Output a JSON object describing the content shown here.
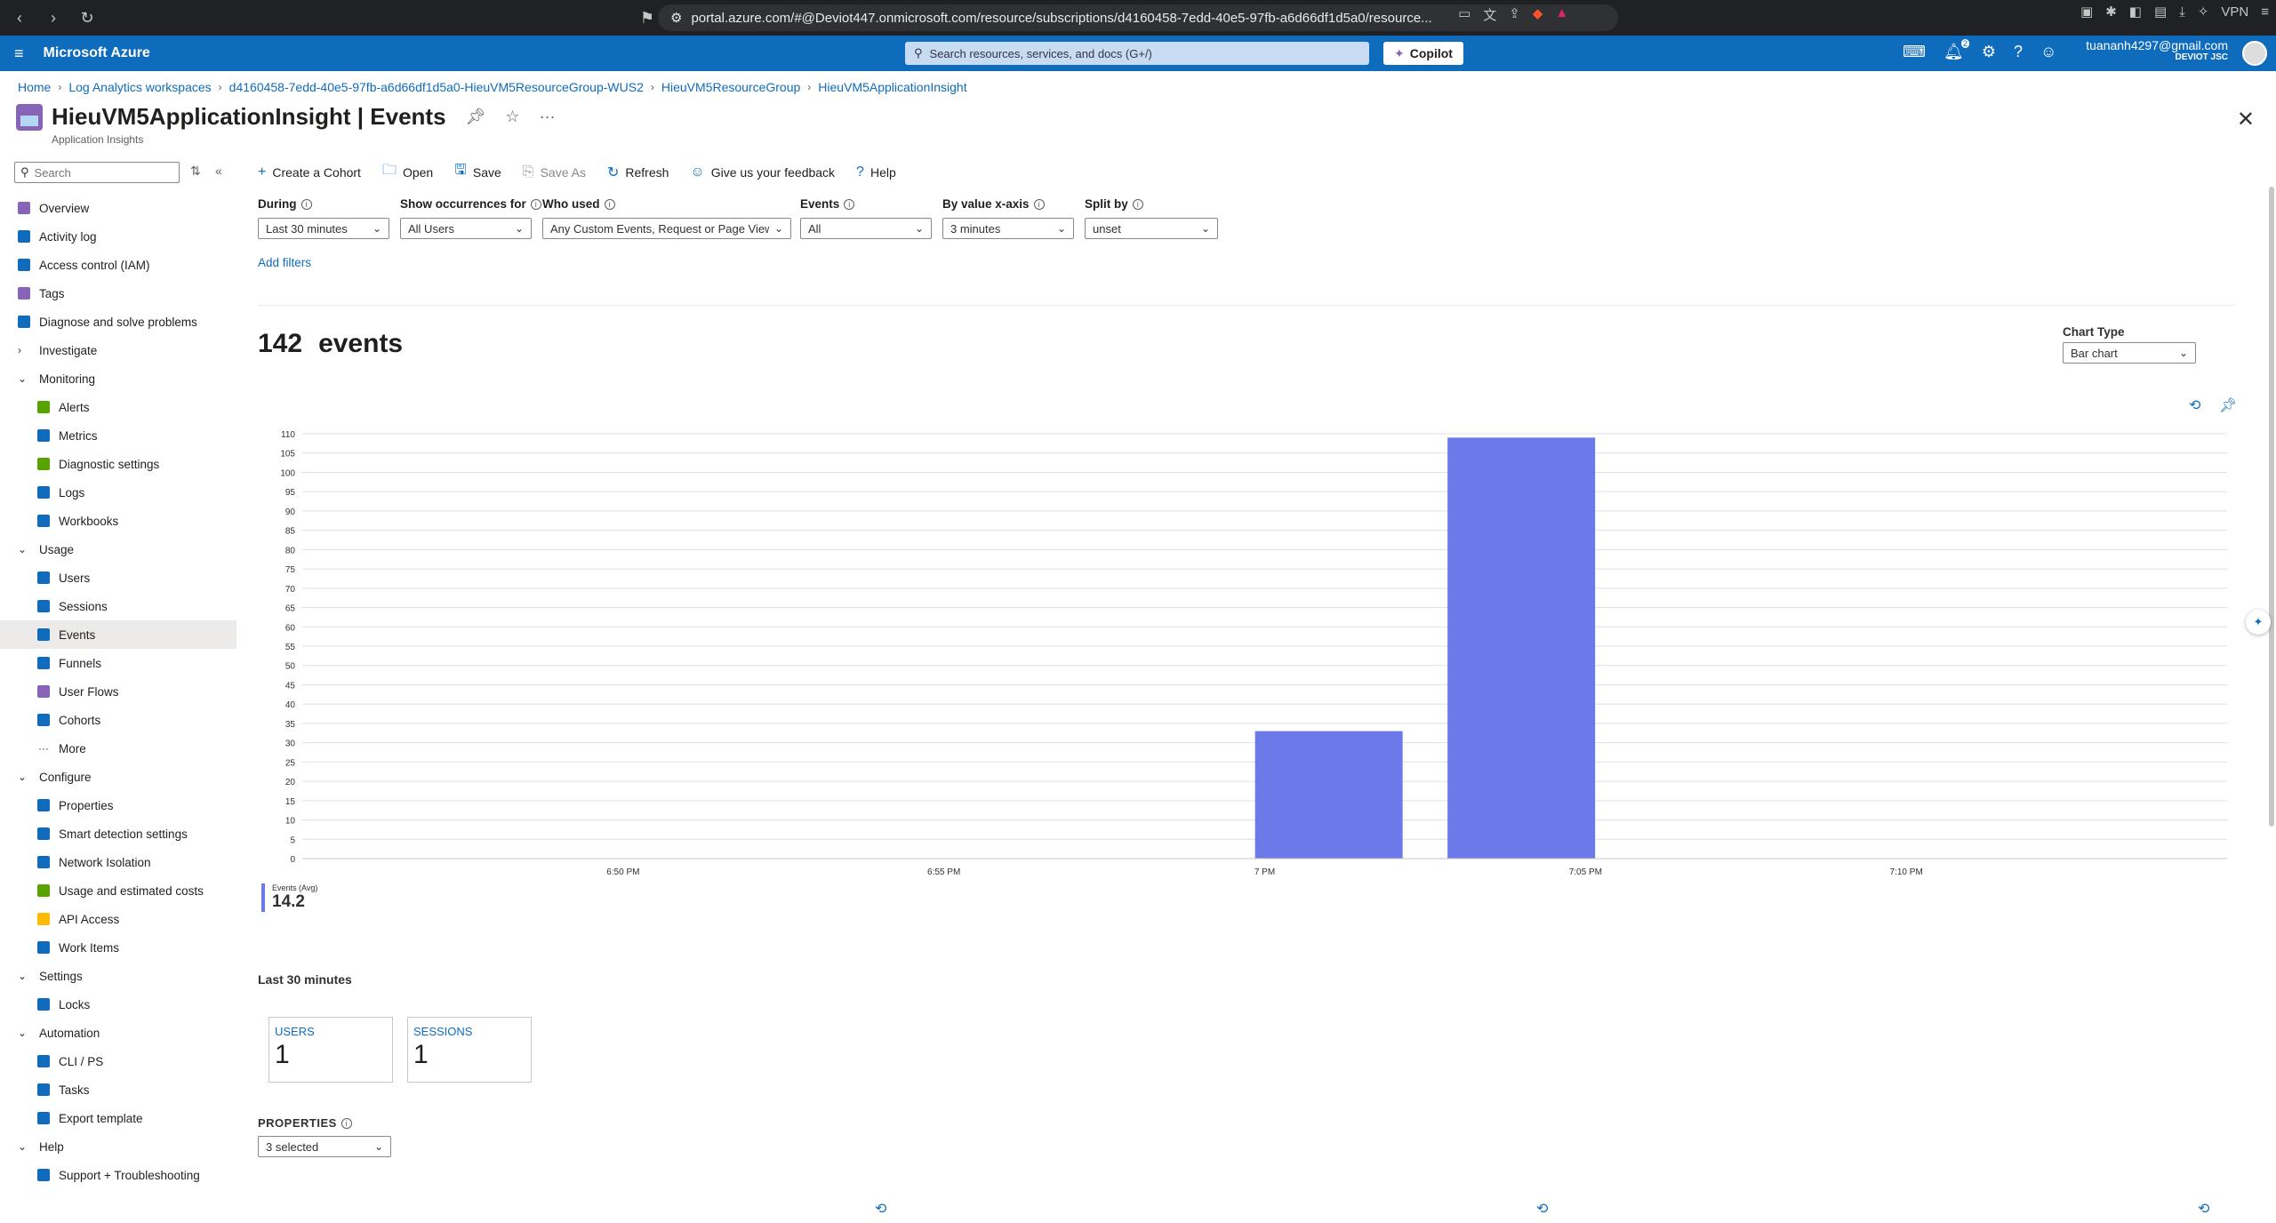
{
  "browser": {
    "url": "portal.azure.com/#@Deviot447.onmicrosoft.com/resource/subscriptions/d4160458-7edd-40e5-97fb-a6d66df1d5a0/resource...",
    "vpn": "VPN"
  },
  "header": {
    "brand": "Microsoft Azure",
    "search_placeholder": "Search resources, services, and docs (G+/)",
    "copilot": "Copilot",
    "notifications_badge": "2",
    "email": "tuananh4297@gmail.com",
    "org": "DEVIOT JSC"
  },
  "breadcrumb": [
    "Home",
    "Log Analytics workspaces",
    "d4160458-7edd-40e5-97fb-a6d66df1d5a0-HieuVM5ResourceGroup-WUS2",
    "HieuVM5ResourceGroup",
    "HieuVM5ApplicationInsight"
  ],
  "page": {
    "title": "HieuVM5ApplicationInsight | Events",
    "subtitle": "Application Insights"
  },
  "sidebar": {
    "search_placeholder": "Search",
    "items": [
      {
        "label": "Overview",
        "level": "top",
        "icon": "overview-icon",
        "color": "#8764b8"
      },
      {
        "label": "Activity log",
        "level": "top",
        "icon": "activity-log-icon",
        "color": "#0f6cbd"
      },
      {
        "label": "Access control (IAM)",
        "level": "top",
        "icon": "iam-icon",
        "color": "#0f6cbd"
      },
      {
        "label": "Tags",
        "level": "top",
        "icon": "tag-icon",
        "color": "#8764b8"
      },
      {
        "label": "Diagnose and solve problems",
        "level": "top",
        "icon": "wrench-icon",
        "color": "#0f6cbd"
      },
      {
        "label": "Investigate",
        "level": "group",
        "expanded": false
      },
      {
        "label": "Monitoring",
        "level": "group",
        "expanded": true
      },
      {
        "label": "Alerts",
        "level": "sub",
        "icon": "alerts-icon",
        "color": "#57a300"
      },
      {
        "label": "Metrics",
        "level": "sub",
        "icon": "metrics-icon",
        "color": "#0f6cbd"
      },
      {
        "label": "Diagnostic settings",
        "level": "sub",
        "icon": "diagnostic-settings-icon",
        "color": "#57a300"
      },
      {
        "label": "Logs",
        "level": "sub",
        "icon": "logs-icon",
        "color": "#0f6cbd"
      },
      {
        "label": "Workbooks",
        "level": "sub",
        "icon": "workbooks-icon",
        "color": "#0f6cbd"
      },
      {
        "label": "Usage",
        "level": "group",
        "expanded": true
      },
      {
        "label": "Users",
        "level": "sub",
        "icon": "users-icon",
        "color": "#0f6cbd"
      },
      {
        "label": "Sessions",
        "level": "sub",
        "icon": "sessions-icon",
        "color": "#0f6cbd"
      },
      {
        "label": "Events",
        "level": "sub",
        "icon": "events-icon",
        "color": "#0f6cbd",
        "active": true
      },
      {
        "label": "Funnels",
        "level": "sub",
        "icon": "funnels-icon",
        "color": "#0f6cbd"
      },
      {
        "label": "User Flows",
        "level": "sub",
        "icon": "user-flows-icon",
        "color": "#8764b8"
      },
      {
        "label": "Cohorts",
        "level": "sub",
        "icon": "cohorts-icon",
        "color": "#0f6cbd"
      },
      {
        "label": "More",
        "level": "sub",
        "icon": "more-icon",
        "color": "#323130"
      },
      {
        "label": "Configure",
        "level": "group",
        "expanded": true
      },
      {
        "label": "Properties",
        "level": "sub",
        "icon": "properties-icon",
        "color": "#0f6cbd"
      },
      {
        "label": "Smart detection settings",
        "level": "sub",
        "icon": "smart-detection-icon",
        "color": "#0f6cbd"
      },
      {
        "label": "Network Isolation",
        "level": "sub",
        "icon": "network-isolation-icon",
        "color": "#0f6cbd"
      },
      {
        "label": "Usage and estimated costs",
        "level": "sub",
        "icon": "costs-icon",
        "color": "#57a300"
      },
      {
        "label": "API Access",
        "level": "sub",
        "icon": "api-key-icon",
        "color": "#ffb900"
      },
      {
        "label": "Work Items",
        "level": "sub",
        "icon": "work-items-icon",
        "color": "#0f6cbd"
      },
      {
        "label": "Settings",
        "level": "group",
        "expanded": true
      },
      {
        "label": "Locks",
        "level": "sub",
        "icon": "lock-icon",
        "color": "#0f6cbd"
      },
      {
        "label": "Automation",
        "level": "group",
        "expanded": true
      },
      {
        "label": "CLI / PS",
        "level": "sub",
        "icon": "cli-icon",
        "color": "#0f6cbd"
      },
      {
        "label": "Tasks",
        "level": "sub",
        "icon": "tasks-icon",
        "color": "#0f6cbd"
      },
      {
        "label": "Export template",
        "level": "sub",
        "icon": "export-template-icon",
        "color": "#0f6cbd"
      },
      {
        "label": "Help",
        "level": "group",
        "expanded": true
      },
      {
        "label": "Support + Troubleshooting",
        "level": "sub",
        "icon": "support-icon",
        "color": "#0f6cbd"
      }
    ]
  },
  "toolbar": {
    "create_cohort": "Create a Cohort",
    "open": "Open",
    "save": "Save",
    "save_as": "Save As",
    "refresh": "Refresh",
    "feedback": "Give us your feedback",
    "help": "Help"
  },
  "filters": {
    "during": {
      "label": "During",
      "value": "Last 30 minutes"
    },
    "occurrences": {
      "label": "Show occurrences for",
      "value": "All Users"
    },
    "who_used": {
      "label": "Who used",
      "value": "Any Custom Events, Request or Page View"
    },
    "events": {
      "label": "Events",
      "value": "All"
    },
    "x_axis": {
      "label": "By value x-axis",
      "value": "3 minutes"
    },
    "split_by": {
      "label": "Split by",
      "value": "unset"
    },
    "add_filters": "Add filters"
  },
  "summary": {
    "count": "142",
    "count_label": "events"
  },
  "chart_type": {
    "label": "Chart Type",
    "value": "Bar chart"
  },
  "chart_data": {
    "type": "bar",
    "y_ticks": [
      0,
      5,
      10,
      15,
      20,
      25,
      30,
      35,
      40,
      45,
      50,
      55,
      60,
      65,
      70,
      75,
      80,
      85,
      90,
      95,
      100,
      105,
      110
    ],
    "ylim": [
      0,
      110
    ],
    "x_time_labels": [
      "6:50 PM",
      "6:55 PM",
      "7 PM",
      "7:05 PM",
      "7:10 PM"
    ],
    "bars": [
      {
        "time": "7:01 PM",
        "value": 33
      },
      {
        "time": "7:04 PM",
        "value": 109
      }
    ],
    "color": "#6b7ae8",
    "grid": true,
    "legend": {
      "name": "Events (Avg)",
      "value": "14.2"
    }
  },
  "stats": {
    "range_label": "Last 30 minutes",
    "tiles": [
      {
        "title": "USERS",
        "value": "1"
      },
      {
        "title": "SESSIONS",
        "value": "1"
      }
    ]
  },
  "properties": {
    "label": "PROPERTIES",
    "value": "3 selected"
  }
}
